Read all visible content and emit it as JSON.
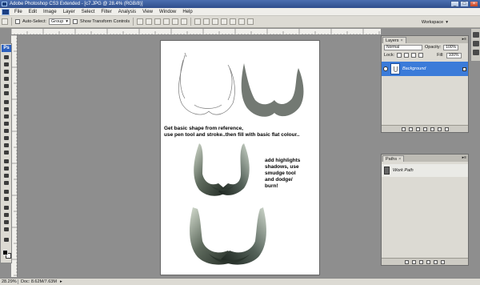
{
  "window": {
    "title": "Adobe Photoshop CS3 Extended - [c7.JPG @ 28.4% (RGB/8)]",
    "minimize": "_",
    "maximize": "□",
    "close": "×"
  },
  "menu": [
    "File",
    "Edit",
    "Image",
    "Layer",
    "Select",
    "Filter",
    "Analysis",
    "View",
    "Window",
    "Help"
  ],
  "options": {
    "auto_select_label": "Auto-Select:",
    "auto_select_value": "Group",
    "show_transform_label": "Show Transform Controls",
    "workspace_label": "Workspace"
  },
  "toolbox": {
    "badge": "Ps"
  },
  "document": {
    "caption1_line1": "Get basic shape from reference,",
    "caption1_line2": "use pen tool and stroke..then fill with basic flat colour..",
    "caption2": [
      "add highlights",
      "shadows, use",
      "smudge tool",
      "and dodge/",
      "burn!"
    ]
  },
  "status": {
    "zoom": "28.29%",
    "doc": "Doc: 8.62M/7.63M"
  },
  "layers_panel": {
    "tab": "Layers",
    "blend_mode": "Normal",
    "opacity_label": "Opacity:",
    "opacity_value": "100%",
    "lock_label": "Lock:",
    "fill_label": "Fill:",
    "fill_value": "100%",
    "layer_name": "Background"
  },
  "paths_panel": {
    "tab": "Paths",
    "path_name": "Work Path"
  },
  "colors": {
    "selection": "#3b7bd9",
    "canvas_bg": "#8e8e8e",
    "panel_bg": "#dcdad3"
  }
}
